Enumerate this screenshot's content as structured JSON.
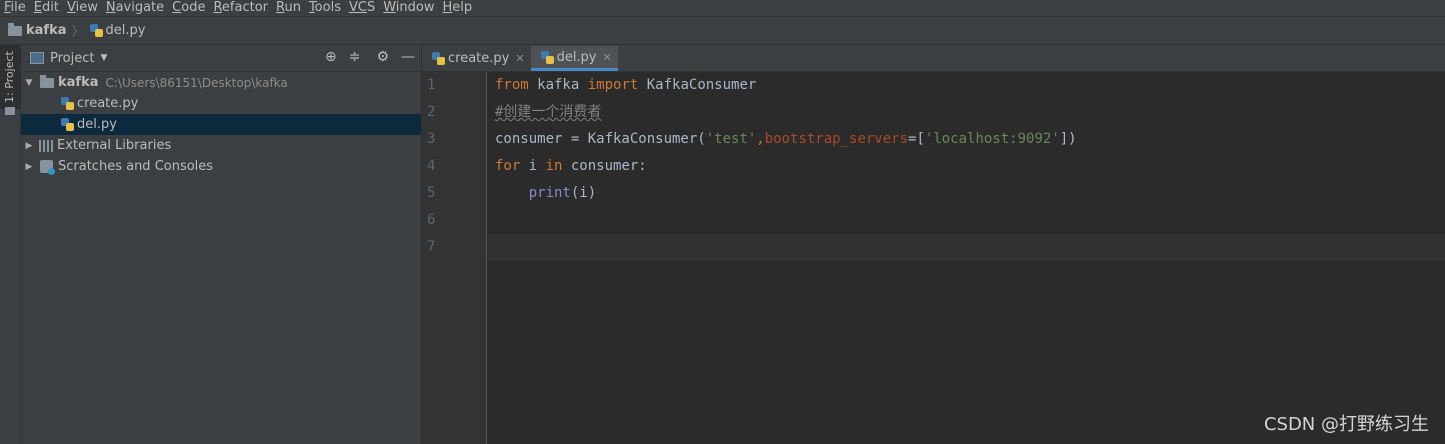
{
  "menu": [
    {
      "mn": "F",
      "rest": "ile"
    },
    {
      "mn": "E",
      "rest": "dit"
    },
    {
      "mn": "V",
      "rest": "iew"
    },
    {
      "mn": "N",
      "rest": "avigate"
    },
    {
      "mn": "C",
      "rest": "ode"
    },
    {
      "mn": "R",
      "rest": "efactor"
    },
    {
      "mn": "R",
      "rest": "un"
    },
    {
      "mn": "T",
      "rest": "ools"
    },
    {
      "mn": "VC",
      "rest": "S"
    },
    {
      "mn": "W",
      "rest": "indow"
    },
    {
      "mn": "H",
      "rest": "elp"
    }
  ],
  "breadcrumb": {
    "project": "kafka",
    "file": "del.py"
  },
  "left_tab": "1: Project",
  "project_panel": {
    "title": "Project",
    "root": {
      "name": "kafka",
      "path": "C:\\Users\\86151\\Desktop\\kafka"
    },
    "files": [
      "create.py",
      "del.py"
    ],
    "external_libraries": "External Libraries",
    "scratches": "Scratches and Consoles"
  },
  "editor_tabs": [
    {
      "label": "create.py",
      "active": false
    },
    {
      "label": "del.py",
      "active": true
    }
  ],
  "line_numbers": [
    "1",
    "2",
    "3",
    "4",
    "5",
    "6",
    "7"
  ],
  "code": {
    "l1": {
      "kw1": "from",
      "mod": " kafka ",
      "kw2": "import",
      "name": " KafkaConsumer"
    },
    "l2": {
      "comment": "#创建一个消费者"
    },
    "l3": {
      "a": "consumer = KafkaConsumer(",
      "s1": "'test'",
      "c": ",",
      "p": "bootstrap_servers",
      "eq": "=[",
      "s2": "'localhost:9092'",
      "end": "])"
    },
    "l4": {
      "kw1": "for",
      "a": " i ",
      "kw2": "in",
      "b": " consumer:"
    },
    "l5": {
      "indent": "    ",
      "fn": "print",
      "args": "(i)"
    }
  },
  "watermark": "CSDN @打野练习生"
}
